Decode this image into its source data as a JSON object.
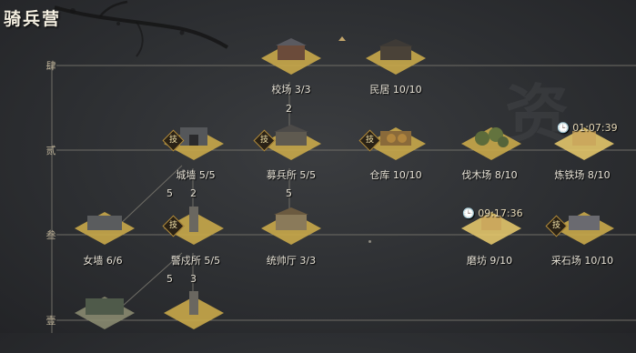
{
  "title": "骑兵营",
  "tiers": [
    "肆",
    "贰",
    "叁",
    "壹"
  ],
  "buildings": [
    {
      "id": "jiaochang",
      "label": "校场 3/3",
      "tech": false,
      "timer": ""
    },
    {
      "id": "minju",
      "label": "民居 10/10",
      "tech": false,
      "timer": ""
    },
    {
      "id": "chengqiang",
      "label": "城墙 5/5",
      "tech": true,
      "timer": ""
    },
    {
      "id": "mubingsuo",
      "label": "募兵所 5/5",
      "tech": true,
      "timer": ""
    },
    {
      "id": "cangku",
      "label": "仓库 10/10",
      "tech": true,
      "timer": ""
    },
    {
      "id": "famuchang",
      "label": "伐木场 8/10",
      "tech": false,
      "timer": ""
    },
    {
      "id": "liantiechang",
      "label": "炼铁场 8/10",
      "tech": false,
      "timer": "01:07:39"
    },
    {
      "id": "nvqiang",
      "label": "女墙 6/6",
      "tech": false,
      "timer": ""
    },
    {
      "id": "jingshuting",
      "label": "警戍所 5/5",
      "tech": true,
      "timer": ""
    },
    {
      "id": "tongshuaiting",
      "label": "统帅厅 3/3",
      "tech": false,
      "timer": ""
    },
    {
      "id": "mofang",
      "label": "磨坊 9/10",
      "tech": false,
      "timer": "09:17:36"
    },
    {
      "id": "caishichang",
      "label": "采石场 10/10",
      "tech": true,
      "timer": ""
    },
    {
      "id": "junying",
      "label": "",
      "tech": false,
      "timer": ""
    },
    {
      "id": "jiantai",
      "label": "",
      "tech": false,
      "timer": ""
    }
  ],
  "tech_badge": "技",
  "costs": [
    "2",
    "5",
    "5",
    "2",
    "5",
    "3"
  ],
  "watermark": "资",
  "colors": {
    "tile_gold": "#d4b24c",
    "line": "#6f6d66",
    "badge_border": "#b48d3c"
  }
}
